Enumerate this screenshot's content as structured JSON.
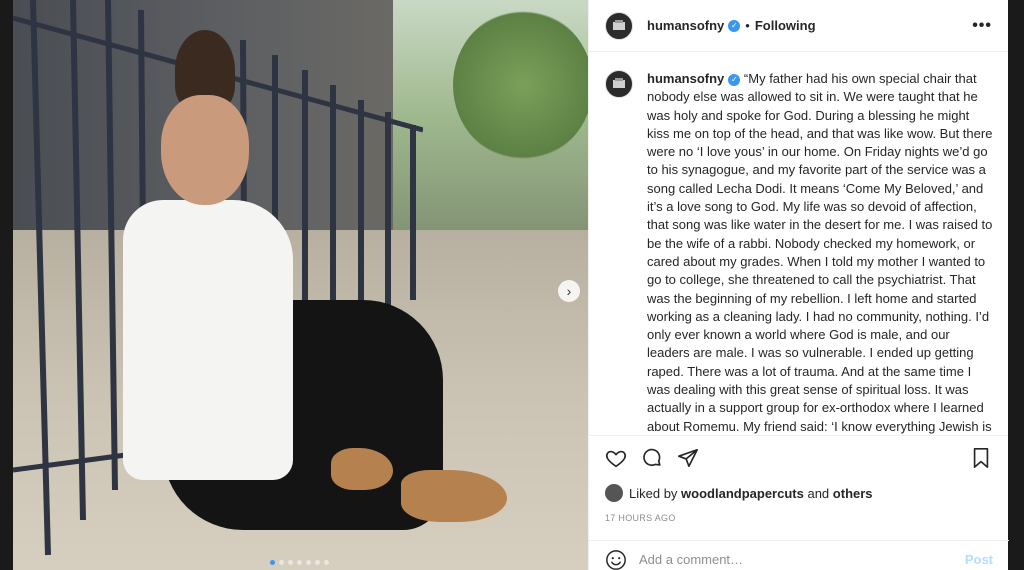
{
  "post": {
    "username": "humansofny",
    "follow_status": "Following",
    "separator": "•",
    "more_label": "•••",
    "caption": "“My father had his own special chair that nobody else was allowed to sit in. We were taught that he was holy and spoke for God. During a blessing he might kiss me on top of the head, and that was like wow. But there were no ‘I love yous’ in our home. On Friday nights we’d go to his synagogue, and my favorite part of the service was a song called Lecha Dodi. It means ‘Come My Beloved,’ and it’s a love song to God. My life was so devoid of affection, that song was like water in the desert for me. I was raised to be the wife of a rabbi. Nobody checked my homework, or cared about my grades. When I told my mother I wanted to go to college, she threatened to call the psychiatrist. That was the beginning of my rebellion. I left home and started working as a cleaning lady. I had no community, nothing. I’d only ever known a world where God is male, and our leaders are male. I was so vulnerable. I ended up getting raped. There was a lot of trauma. And at the same time I was dealing with this great sense of spiritual loss. It was actually in a support group for ex-orthodox where I learned about Romemu. My friend said: ‘I know everything Jewish is toxic, but give this synagogue a try.’ The service was held in a former church. And the first thing the Rabbi said was: ‘We welcome every one of every faith, or no faith.’ His name was David. He was a wounded healer. He’d also grown up Orthodox. He’d been abused as a child. ‘Some of us have been traumatized by God,’ he said. And I needed to hear",
    "likes_prefix": "Liked by",
    "liked_by_user": "woodlandpapercuts",
    "likes_and": "and",
    "likes_others": "others",
    "timestamp": "17 HOURS AGO"
  },
  "comment": {
    "placeholder": "Add a comment…",
    "post_label": "Post"
  },
  "carousel": {
    "next_arrow": "›",
    "slide_count": 7,
    "active_index": 0
  },
  "icons": {
    "verified": "verified-badge-icon",
    "like": "heart-icon",
    "comment": "comment-bubble-icon",
    "share": "paper-plane-icon",
    "save": "bookmark-icon",
    "emoji": "smiley-icon"
  },
  "colors": {
    "accent": "#3897f0",
    "post_disabled": "#b2dffc",
    "text": "#262626",
    "muted": "#8e8e8e"
  }
}
